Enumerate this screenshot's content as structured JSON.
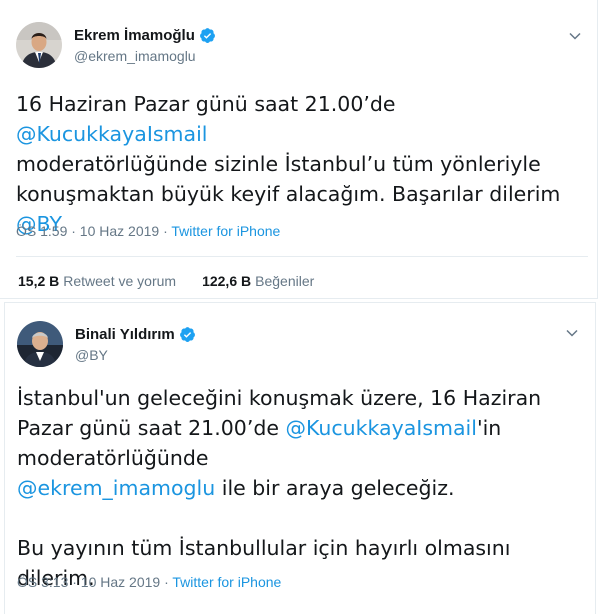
{
  "tweets": [
    {
      "author": "Ekrem İmamoğlu",
      "handle": "@ekrem_imamoglu",
      "text_parts": [
        "16 Haziran Pazar günü saat 21.00’de ",
        "@KucukkayaIsmail",
        " moderatörlüğünde sizinle İstanbul’u tüm yönleriyle konuşmaktan büyük keyif alacağım. Başarılar dilerim ",
        "@BY"
      ],
      "time": "ÖS 1:59 · 10 Haz 2019 · ",
      "source": "Twitter for iPhone",
      "retweets_count": "15,2 B",
      "retweets_label": "Retweet ve yorum",
      "likes_count": "122,6 B",
      "likes_label": "Beğeniler"
    },
    {
      "author": "Binali Yıldırım",
      "handle": "@BY",
      "text_parts": [
        "İstanbul'un geleceğini konuşmak üzere, 16 Haziran Pazar günü saat 21.00’de ",
        "@KucukkayaIsmail",
        "'in moderatörlüğünde",
        "@ekrem_imamoglu",
        " ile bir araya geleceğiz.",
        "Bu yayının tüm İstanbullular için hayırlı olmasını dilerim."
      ],
      "time": "ÖS 3:13 · 10 Haz 2019 · ",
      "source": "Twitter for iPhone"
    }
  ],
  "icons": [
    "verified-badge-icon",
    "chevron-down-icon"
  ],
  "colors": {
    "accent": "#1b95e0",
    "text": "#14171a",
    "muted": "#657786",
    "border": "#e6ecf0"
  }
}
